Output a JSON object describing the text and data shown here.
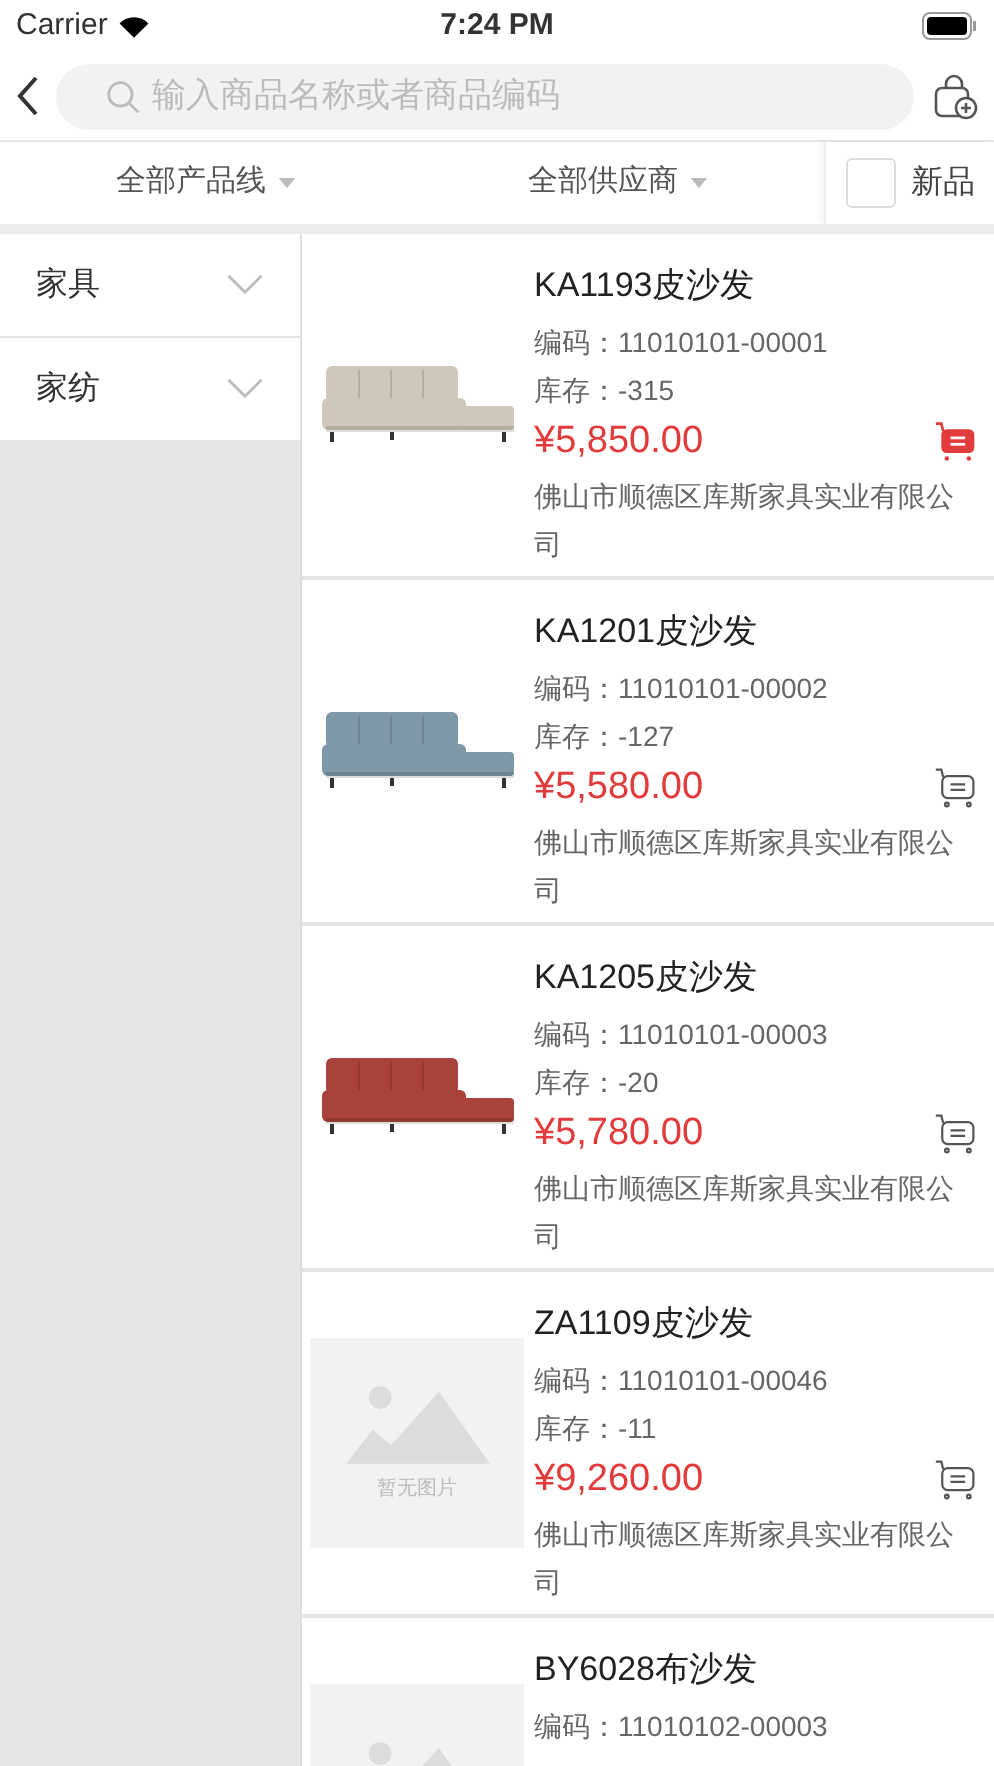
{
  "status_bar": {
    "carrier": "Carrier",
    "time": "7:24 PM"
  },
  "search": {
    "placeholder": "输入商品名称或者商品编码"
  },
  "filters": [
    {
      "label": "全部产品线"
    },
    {
      "label": "全部供应商"
    }
  ],
  "new_only": {
    "label": "新品",
    "checked": false
  },
  "sidebar": {
    "items": [
      {
        "label": "家具",
        "expanded": false
      },
      {
        "label": "家纺",
        "expanded": false
      }
    ]
  },
  "products": [
    {
      "name": "KA1193皮沙发",
      "code_label": "编码：",
      "code": "11010101-00001",
      "stock_label": "库存：",
      "stock": "-315",
      "price": "¥5,850.00",
      "supplier": "佛山市顺德区库斯家具实业有限公司",
      "in_cart": true
    },
    {
      "name": "KA1201皮沙发",
      "code_label": "编码：",
      "code": "11010101-00002",
      "stock_label": "库存：",
      "stock": "-127",
      "price": "¥5,580.00",
      "supplier": "佛山市顺德区库斯家具实业有限公司",
      "in_cart": false
    },
    {
      "name": "KA1205皮沙发",
      "code_label": "编码：",
      "code": "11010101-00003",
      "stock_label": "库存：",
      "stock": "-20",
      "price": "¥5,780.00",
      "supplier": "佛山市顺德区库斯家具实业有限公司",
      "in_cart": false
    },
    {
      "name": "ZA1109皮沙发",
      "code_label": "编码：",
      "code": "11010101-00046",
      "stock_label": "库存：",
      "stock": "-11",
      "price": "¥9,260.00",
      "supplier": "佛山市顺德区库斯家具实业有限公司",
      "in_cart": false,
      "image": {
        "kind": "placeholder",
        "text": "暂无图片"
      }
    },
    {
      "name": "BY6028布沙发",
      "code_label": "编码：",
      "code": "11010102-00003",
      "image": {
        "kind": "placeholder"
      }
    }
  ]
}
